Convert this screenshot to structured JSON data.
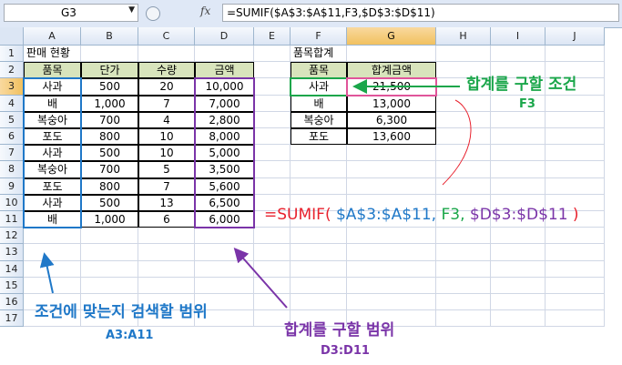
{
  "formula_bar": {
    "name_box": "G3",
    "fx_label": "fx",
    "formula": "=SUMIF($A$3:$A$11,F3,$D$3:$D$11)"
  },
  "columns": [
    "A",
    "B",
    "C",
    "D",
    "E",
    "F",
    "G",
    "H",
    "I",
    "J"
  ],
  "rows": [
    "1",
    "2",
    "3",
    "4",
    "5",
    "6",
    "7",
    "8",
    "9",
    "10",
    "11",
    "12",
    "13",
    "14",
    "15",
    "16",
    "17"
  ],
  "sheet": {
    "title_a1": "판매 현황",
    "title_f1": "품목합계",
    "table1": {
      "headers": [
        "품목",
        "단가",
        "수량",
        "금액"
      ],
      "rows": [
        [
          "사과",
          "500",
          "20",
          "10,000"
        ],
        [
          "배",
          "1,000",
          "7",
          "7,000"
        ],
        [
          "복숭아",
          "700",
          "4",
          "2,800"
        ],
        [
          "포도",
          "800",
          "10",
          "8,000"
        ],
        [
          "사과",
          "500",
          "10",
          "5,000"
        ],
        [
          "복숭아",
          "700",
          "5",
          "3,500"
        ],
        [
          "포도",
          "800",
          "7",
          "5,600"
        ],
        [
          "사과",
          "500",
          "13",
          "6,500"
        ],
        [
          "배",
          "1,000",
          "6",
          "6,000"
        ]
      ]
    },
    "table2": {
      "headers": [
        "품목",
        "합계금액"
      ],
      "rows": [
        [
          "사과",
          "21,500"
        ],
        [
          "배",
          "13,000"
        ],
        [
          "복숭아",
          "6,300"
        ],
        [
          "포도",
          "13,600"
        ]
      ]
    }
  },
  "annotations": {
    "condition_title": "합계를 구할 조건",
    "condition_ref": "F3",
    "formula_parts": {
      "p1": "=SUMIF(",
      "p2": " $A$3:$A$11,",
      "p3": " F3,",
      "p4": " $D$3:$D$11",
      "p5": " )"
    },
    "search_range_title": "조건에 맞는지 검색할 범위",
    "search_range_ref": "A3:A11",
    "sum_range_title": "합계를 구할 범위",
    "sum_range_ref": "D3:D11"
  },
  "colors": {
    "header_fill": "#d8e4bc",
    "blue": "#1f78c8",
    "green": "#1aa64a",
    "purple": "#7a34a8",
    "red": "#e8222e",
    "pink": "#e0559a"
  }
}
